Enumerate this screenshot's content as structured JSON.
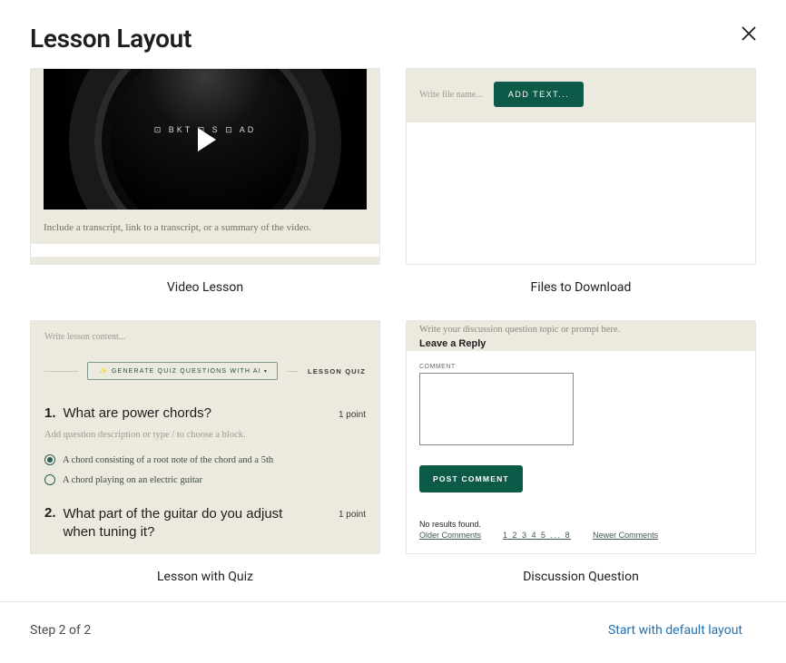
{
  "header": {
    "title": "Lesson Layout"
  },
  "cards": {
    "video": {
      "label": "Video Lesson",
      "camera_text": "⊡ BKT ⊡   S  ⊡ AD",
      "caption": "Include a transcript, link to a transcript, or a summary of the video."
    },
    "files": {
      "label": "Files to Download",
      "file_placeholder": "Write file name...",
      "add_text_btn": "ADD TEXT..."
    },
    "quiz": {
      "label": "Lesson with Quiz",
      "write_placeholder": "Write lesson content...",
      "generate_btn": "✨  GENERATE QUIZ QUESTIONS WITH AI",
      "section_label": "LESSON QUIZ",
      "q1_num": "1.",
      "q1_text": "What are power chords?",
      "q1_points": "1 point",
      "q1_desc": "Add question description or type / to choose a block.",
      "q1_opt1": "A chord consisting of a root note of the chord and a 5th",
      "q1_opt2": "A chord playing on an electric guitar",
      "q2_num": "2.",
      "q2_text": "What part of the guitar do you adjust when tuning it?",
      "q2_points": "1 point"
    },
    "discussion": {
      "label": "Discussion Question",
      "prompt": "Write your discussion question topic or prompt here.",
      "leave_reply": "Leave a Reply",
      "comment_label": "COMMENT",
      "post_btn": "POST COMMENT",
      "no_results": "No results found.",
      "older": "Older Comments",
      "pages": "1 2 3 4 5 ... 8",
      "newer": "Newer Comments"
    }
  },
  "footer": {
    "step": "Step 2 of 2",
    "default_link": "Start with default layout"
  }
}
